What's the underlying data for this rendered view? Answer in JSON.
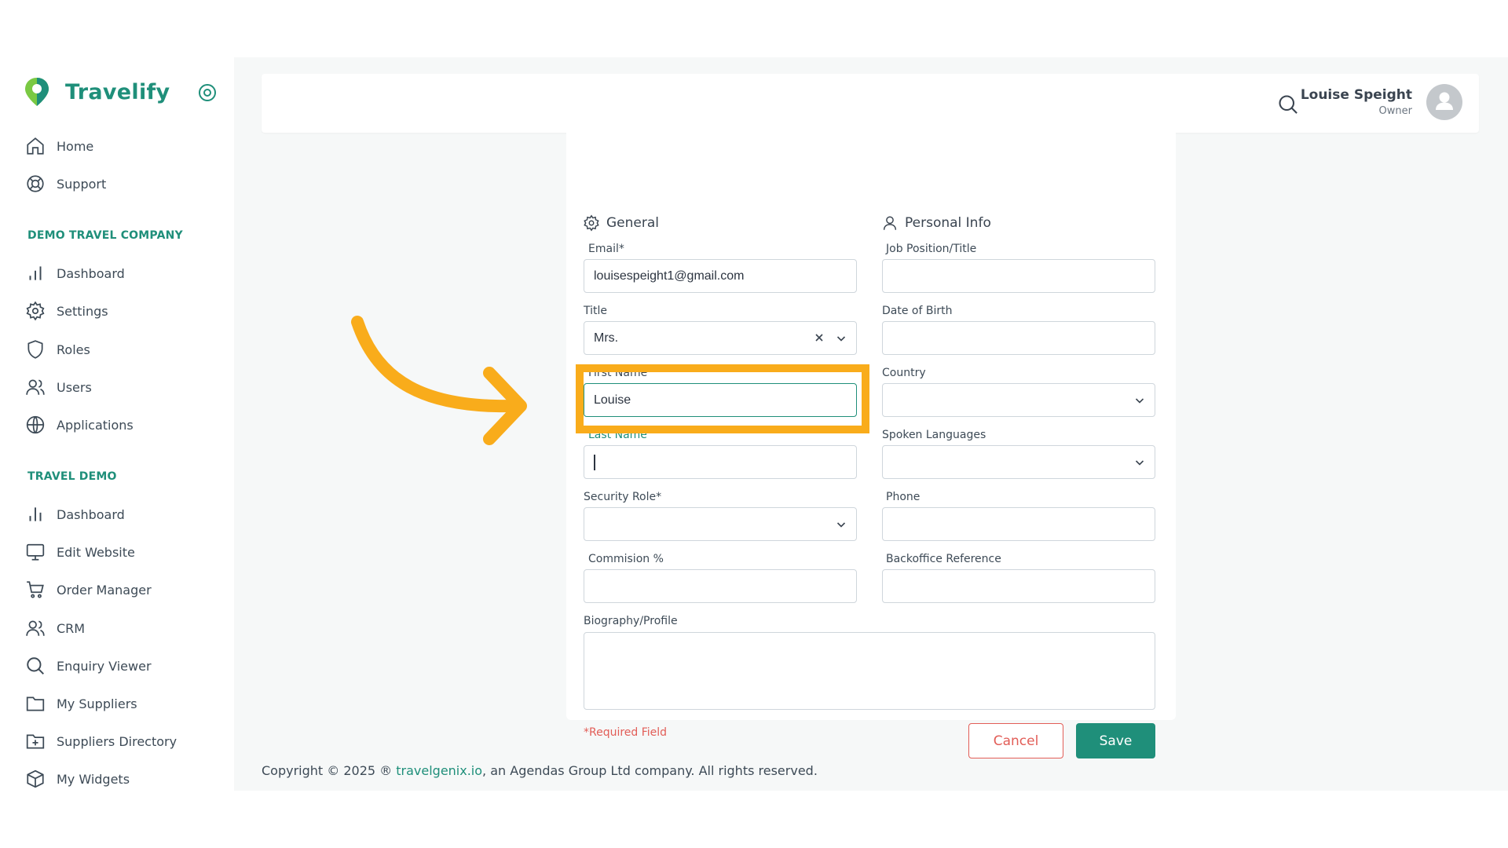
{
  "brand": {
    "name": "Travelify",
    "accent": "#1f8f7a"
  },
  "sidebar": {
    "top_items": [
      {
        "label": "Home",
        "icon": "home-icon"
      },
      {
        "label": "Support",
        "icon": "lifebuoy-icon"
      }
    ],
    "sections": [
      {
        "title": "DEMO TRAVEL COMPANY",
        "items": [
          {
            "label": "Dashboard",
            "icon": "bar-chart-icon"
          },
          {
            "label": "Settings",
            "icon": "gear-icon"
          },
          {
            "label": "Roles",
            "icon": "shield-icon"
          },
          {
            "label": "Users",
            "icon": "users-icon"
          },
          {
            "label": "Applications",
            "icon": "globe-icon"
          }
        ]
      },
      {
        "title": "TRAVEL DEMO",
        "items": [
          {
            "label": "Dashboard",
            "icon": "bar-chart-icon"
          },
          {
            "label": "Edit Website",
            "icon": "monitor-icon"
          },
          {
            "label": "Order Manager",
            "icon": "cart-icon"
          },
          {
            "label": "CRM",
            "icon": "users-icon"
          },
          {
            "label": "Enquiry Viewer",
            "icon": "search-icon"
          },
          {
            "label": "My Suppliers",
            "icon": "folder-icon"
          },
          {
            "label": "Suppliers Directory",
            "icon": "folder-plus-icon"
          },
          {
            "label": "My Widgets",
            "icon": "cube-icon"
          }
        ]
      }
    ]
  },
  "header": {
    "user_name": "Louise Speight",
    "user_role": "Owner"
  },
  "form": {
    "general_title": "General",
    "personal_title": "Personal Info",
    "email": {
      "label": "Email*",
      "value": "louisespeight1@gmail.com"
    },
    "title": {
      "label": "Title",
      "value": "Mrs."
    },
    "first_name": {
      "label": "First Name",
      "value": "Louise"
    },
    "last_name": {
      "label": "Last Name",
      "value": ""
    },
    "security_role": {
      "label": "Security Role*",
      "value": ""
    },
    "commission": {
      "label": "Commision %",
      "value": ""
    },
    "job_position": {
      "label": "Job Position/Title",
      "value": ""
    },
    "dob": {
      "label": "Date of Birth",
      "value": ""
    },
    "country": {
      "label": "Country",
      "value": ""
    },
    "spoken_languages": {
      "label": "Spoken Languages",
      "value": ""
    },
    "phone": {
      "label": "Phone",
      "value": ""
    },
    "backoffice_ref": {
      "label": "Backoffice Reference",
      "value": ""
    },
    "biography": {
      "label": "Biography/Profile",
      "value": ""
    },
    "required_note": "*Required Field",
    "cancel_label": "Cancel",
    "save_label": "Save"
  },
  "footer": {
    "prefix": "Copyright © 2025 ® ",
    "link": "travelgenix.io",
    "suffix": ", an Agendas Group Ltd company. All rights reserved."
  },
  "annotation": {
    "highlight_color": "#f9ac1b"
  }
}
